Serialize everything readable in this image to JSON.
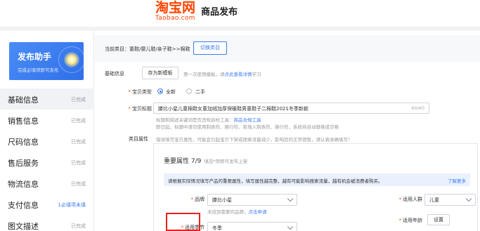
{
  "header": {
    "logo_cn": "淘宝网",
    "logo_en": "Taobao.com",
    "title": "商品发布"
  },
  "sidebar": {
    "helper": {
      "title": "发布助手",
      "subtitle": "完成必填项即可发布"
    },
    "items": [
      {
        "label": "基础信息",
        "status": "已完成",
        "active": true
      },
      {
        "label": "销售信息",
        "status": "已完成"
      },
      {
        "label": "尺码信息",
        "status": "已完成"
      },
      {
        "label": "售后服务",
        "status": "已完成"
      },
      {
        "label": "物流信息",
        "status": "已完成"
      },
      {
        "label": "支付信息",
        "status": "1必填项未填"
      },
      {
        "label": "图文描述",
        "status": "已完成"
      }
    ]
  },
  "category": {
    "current": "当前类目：童鞋/婴儿鞋/亲子鞋>>棉鞋",
    "switch_label": "切换类目"
  },
  "basic": {
    "section_label": "基础信息",
    "template_button": "存为新模板",
    "template_hint_prefix": "第一次使用模板，请",
    "template_hint_link": "点此查看详情",
    "template_hint_suffix": "学习"
  },
  "form": {
    "type_label": "宝贝类型",
    "type_options": [
      "全新",
      "二手"
    ],
    "title_label": "宝贝标题",
    "title_value": "滕比小星儿童棉鞋女童加绒加厚保暖鞋男童鞋子二棉鞋2021冬季新款",
    "title_count": "60/60",
    "title_hint1_prefix": "标题和描述关键词是否违规自检工具：",
    "title_hint1_link": "商品合规工具",
    "title_hint2": "即日起，标题中请勿使用制表符、换行符、若填入制表符、换行符，系统将自动替换成空格",
    "attr_label": "类目属性",
    "attr_hint": "错误填写宝贝属性，可能会引起宝贝下架或搜索流量减少，影响您的正常销售，请认真准确填写！"
  },
  "attributes": {
    "title": "重要属性",
    "count": "7/9",
    "sub": "填完*项即可发布上架",
    "notice": "请根据实际情况填写产品的重要属性，填写属性越完整，越有可能影响搜索流量，越有机会被消费者购买。",
    "notice_link": "了解更多",
    "brand_label": "品牌",
    "brand_value": "滕比小星",
    "brand_hint_prefix": "未找到需要的品牌，",
    "brand_hint_link": "点击申请",
    "season_label": "适用季节",
    "season_value": "冬季",
    "people_label": "适用人群",
    "people_value": "儿童",
    "age_label": "适用年龄",
    "age_button": "设置"
  }
}
